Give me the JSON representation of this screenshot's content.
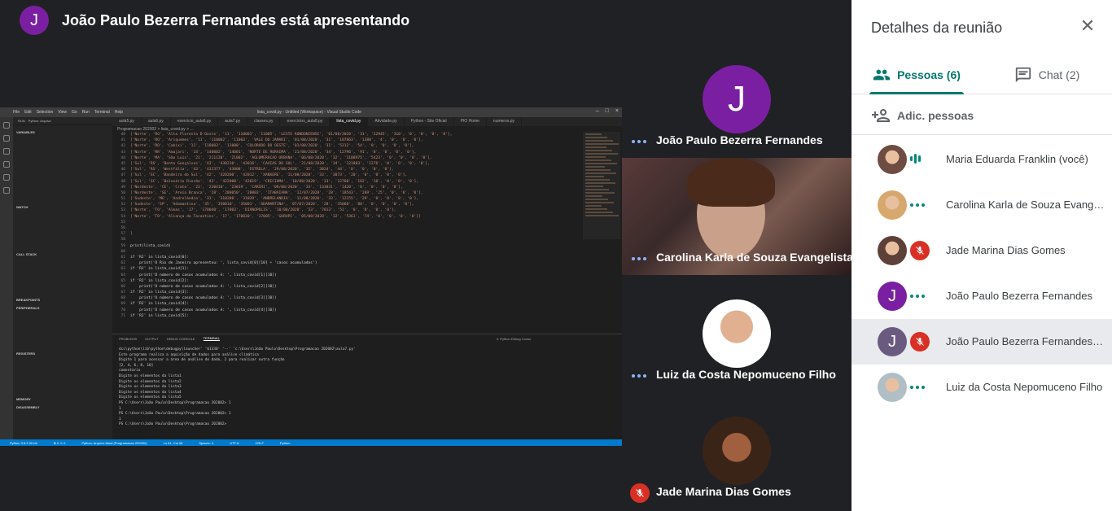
{
  "presenter": {
    "initial": "J",
    "text": "João Paulo Bezerra Fernandes está apresentando"
  },
  "shared_screen": {
    "vscode": {
      "menu": [
        "File",
        "Edit",
        "Selection",
        "View",
        "Go",
        "Run",
        "Terminal",
        "Help"
      ],
      "window_title": "lista_covid.py - Untitled (Workspace) - Visual Studio Code",
      "sidebar_header": "RUN",
      "sidebar_config": "Python: Arquivo",
      "sidebar_sections": [
        "VARIABLES",
        "WATCH",
        "CALL STACK",
        "BREAKPOINTS",
        "PERIPHERALS",
        "REGISTERS",
        "MEMORY",
        "DISASSEMBLY"
      ],
      "tabs": [
        "aula5.py",
        "aula6.py",
        "exercicio_aula6.py",
        "aula7.py",
        "classes.py",
        "exercicios_aula8.py",
        "lista_covid.py",
        "Atividade.py",
        "Python - Site Oficial",
        "PIO Home",
        "numeros.py"
      ],
      "breadcrumb": "Programacao 202002 > lista_covid.py > ...",
      "code_lines": [
        {
          "n": "40",
          "t": "['Norte', 'RO', 'Alta Floresta D'Oeste', '11', '110001', '11005', 'LESTE RONDONIENSE', '01/08/2020', '31', '22945', '310', '0', '0', '0', '0'],"
        },
        {
          "n": "41",
          "t": "['Norte', 'RO', 'Ariquemes', '11', '110002', '11003', 'VALE DO JAMARI', '01/08/2020', '31', '107863', '1380', '4', '0', '0', '0'],"
        },
        {
          "n": "42",
          "t": "['Norte', 'RO', 'Cabixi', '11', '110003', '11008', 'COLORADO DO OESTE', '01/08/2020', '31', '5312', '54', '0', '0', '0', '0'],"
        },
        {
          "n": "43",
          "t": "['Norte', 'RR', 'Amajari', '14', '140002', '14001', 'NORTE DE RORAIMA', '21/08/2020', '34', '12796', '91', '0', '0', '0', '0'],"
        },
        {
          "n": "44",
          "t": "['Norte', 'MA', 'São Luís', '21', '211130', '21002', 'AGLOMERACAO URBANA', '06/08/2020', '32', '1108975', '5423', '0', '0', '0', '0'],"
        },
        {
          "n": "45",
          "t": "['Sul', 'RS', 'Bento Gonçalves', '43', '430210', '43016', 'CAXIAS DO SUL', '21/08/2020', '34', '121803', '1276', '0', '0', '0', '0'],"
        },
        {
          "n": "46",
          "t": "['Sul', 'RS', 'Westfália', '43', '432377', '43008', 'ESTRELA', '29/08/2020', '35', '3024', '44', '0', '0', '0', '0'],"
        },
        {
          "n": "47",
          "t": "['Sul', 'SC', 'Bandeira do Sul', '42', '420200', '42012', 'XANXERE', '11/08/2020', '33', '3073', '20', '0', '0', '0', '0'],"
        },
        {
          "n": "48",
          "t": "['Sul', 'SC', 'Balneário Rincão', '42', '422000', '42019', 'CRICIUMA', '10/08/2020', '33', '12760', '182', '10', '0', '0', '0'],"
        },
        {
          "n": "49",
          "t": "['Nordeste', 'CE', 'Crato', '23', '230410', '23019', 'CARIRI', '09/08/2020', '33', '133031', '1420', '0', '0', '0', '0'],"
        },
        {
          "n": "50",
          "t": "['Nordeste', 'SE', 'Areia Branca', '28', '280050', '28003', 'ITABAIANA', '12/07/2020', '28', '18543', '289', '25', '0', '0', '0'],"
        },
        {
          "n": "51",
          "t": "['Sudeste', 'MG', 'Andrelândia', '31', '310280', '31039', 'ANDRELANDIA', '11/08/2020', '33', '12155', '29', '0', '0', '0', '0'],"
        },
        {
          "n": "52",
          "t": "['Sudeste', 'SP', 'Adamantina', '35', '350010', '35001', 'ADAMANTINA', '07/07/2020', '28', '35068', '80', '0', '0', '0', '0'],"
        },
        {
          "n": "53",
          "t": "['Norte', 'TO', 'Almas', '17', '170040', '17003', 'DIANOPOLIS', '10/08/2020', '33', '7013', '51', '0', '0', '0', '0'],"
        },
        {
          "n": "54",
          "t": "['Norte', 'TO', 'Aliança do Tocantins', '17', '170030', '17005', 'GURUPI', '05/08/2020', '32', '5361', '74', '0', '0', '0', '0']]"
        },
        {
          "n": "55",
          "t": ""
        },
        {
          "n": "56",
          "t": ""
        },
        {
          "n": "57",
          "t": "]"
        },
        {
          "n": "58",
          "t": ""
        },
        {
          "n": "59",
          "t": "print(lista_covid)"
        },
        {
          "n": "60",
          "t": ""
        },
        {
          "n": "61",
          "t": "if 'RJ' in lista_covid[0]:"
        },
        {
          "n": "62",
          "t": "    print('O Rio de Janeiro apresentou: ', lista_covid[0][10] + 'casos acumulados')"
        },
        {
          "n": "63",
          "t": "if 'RJ' in lista_covid[1]:"
        },
        {
          "n": "64",
          "t": "    print('O número de casos acumulados é: ', lista_covid[1][10])"
        },
        {
          "n": "65",
          "t": "if 'RJ' in lista_covid[2]:"
        },
        {
          "n": "66",
          "t": "    print('O número de casos acumulados é: ', lista_covid[2][10])"
        },
        {
          "n": "67",
          "t": "if 'RJ' in lista_covid[3]:"
        },
        {
          "n": "68",
          "t": "    print('O número de casos acumulados é: ', lista_covid[3][10])"
        },
        {
          "n": "69",
          "t": "if 'RJ' in lista_covid[4]:"
        },
        {
          "n": "70",
          "t": "    print('O número de casos acumulados é: ', lista_covid[4][10])"
        },
        {
          "n": "71",
          "t": "if 'RJ' in lista_covid[5]:"
        }
      ],
      "panel_tabs": [
        "PROBLEMS",
        "OUTPUT",
        "DEBUG CONSOLE",
        "TERMINAL"
      ],
      "panel_dropdown": "2: Python Debug Conso",
      "terminal_lines": [
        "dcc\\python\\lib\\python\\debugpy\\launcher' '61330' '--' 'c:\\Users\\João Paulo\\Desktop\\Programacao 202002\\aula7.py'",
        "Este programa realiza a aquisição de dados para análise climática",
        "Digite 1 para acessar a área de análise de dado, 2 para realizar outra função",
        "[2, 4, 6, 8, 10]",
        "comentario",
        "Digite os elementos da lista1",
        "Digite os elementos da lista2",
        "Digite os elementos da lista3",
        "Digite os elementos da lista4",
        "Digite os elementos da lista5",
        "PS C:\\Users\\João Paulo\\Desktop\\Programacao 202002> 1",
        "1",
        "PS C:\\Users\\João Paulo\\Desktop\\Programacao 202002> 1",
        "1",
        "PS C:\\Users\\João Paulo\\Desktop\\Programacao 202002> "
      ],
      "statusbar": [
        "Python 3.8.3 32-bit",
        "⊗ 0 ⚠ 0",
        "Python: Arquivo Atual (Programacao 202002)",
        "Ln 51, Col 26",
        "Spaces: 4",
        "UTF-8",
        "CRLF",
        "Python"
      ]
    }
  },
  "tiles": [
    {
      "name": "João Paulo Bezerra Fernandes",
      "initial": "J",
      "avatar_color": "#7b1fa2",
      "status": "dots"
    },
    {
      "name": "Carolina Karla de Souza Evangelista",
      "status": "dots",
      "video": true
    },
    {
      "name": "Luiz da Costa Nepomuceno Filho",
      "status": "dots"
    },
    {
      "name": "Jade Marina Dias Gomes",
      "status": "mic-off"
    }
  ],
  "details": {
    "title": "Detalhes da reunião",
    "close_icon": "close-icon",
    "tabs": [
      {
        "label": "Pessoas (6)",
        "icon": "people-icon",
        "active": true
      },
      {
        "label": "Chat (2)",
        "icon": "chat-icon",
        "active": false
      }
    ],
    "add_people": "Adic. pessoas",
    "people": [
      {
        "name": "Maria Eduarda Franklin (você)",
        "status": "speaking",
        "avatar_color": "#6d4c41"
      },
      {
        "name": "Carolina Karla de Souza Evangelista",
        "status": "dots",
        "avatar_color": "#d7a86e"
      },
      {
        "name": "Jade Marina Dias Gomes",
        "status": "mic-off",
        "avatar_color": "#5d4037"
      },
      {
        "name": "João Paulo Bezerra Fernandes",
        "status": "dots",
        "initial": "J",
        "avatar_color": "#7b1fa2"
      },
      {
        "name": "João Paulo Bezerra Fernandes (Apresentação)",
        "status": "mic-off",
        "initial": "J",
        "avatar_color": "#6a5a80",
        "selected": true
      },
      {
        "name": "Luiz da Costa Nepomuceno Filho",
        "status": "dots",
        "avatar_color": "#b0bec5"
      }
    ]
  },
  "colors": {
    "accent": "#00796b",
    "mic_off": "#d93025",
    "avatar_purple": "#7b1fa2",
    "background": "#202124"
  }
}
